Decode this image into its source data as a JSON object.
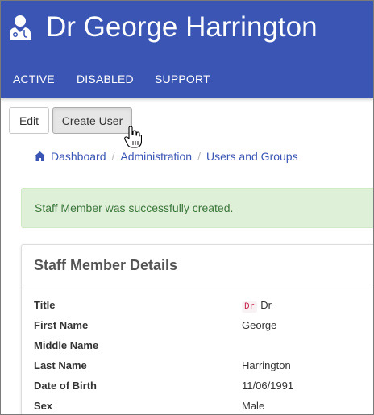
{
  "header": {
    "title": "Dr George Harrington",
    "nav": [
      "ACTIVE",
      "DISABLED",
      "SUPPORT"
    ]
  },
  "toolbar": {
    "edit_label": "Edit",
    "create_user_label": "Create User"
  },
  "breadcrumb": [
    "Dashboard",
    "Administration",
    "Users and Groups"
  ],
  "alert": {
    "message": "Staff Member was successfully created."
  },
  "panel": {
    "title": "Staff Member Details",
    "title_badge": "Dr",
    "rows": [
      {
        "label": "Title",
        "value": "Dr"
      },
      {
        "label": "First Name",
        "value": "George"
      },
      {
        "label": "Middle Name",
        "value": ""
      },
      {
        "label": "Last Name",
        "value": "Harrington"
      },
      {
        "label": "Date of Birth",
        "value": "11/06/1991"
      },
      {
        "label": "Sex",
        "value": "Male"
      }
    ]
  },
  "colors": {
    "header_bg": "#3a55b4",
    "link": "#3a55b4",
    "alert_bg": "#dff0d8",
    "alert_text": "#3c763d"
  },
  "icons": [
    "doctor-icon",
    "home-icon",
    "hand-pointer-cursor"
  ]
}
